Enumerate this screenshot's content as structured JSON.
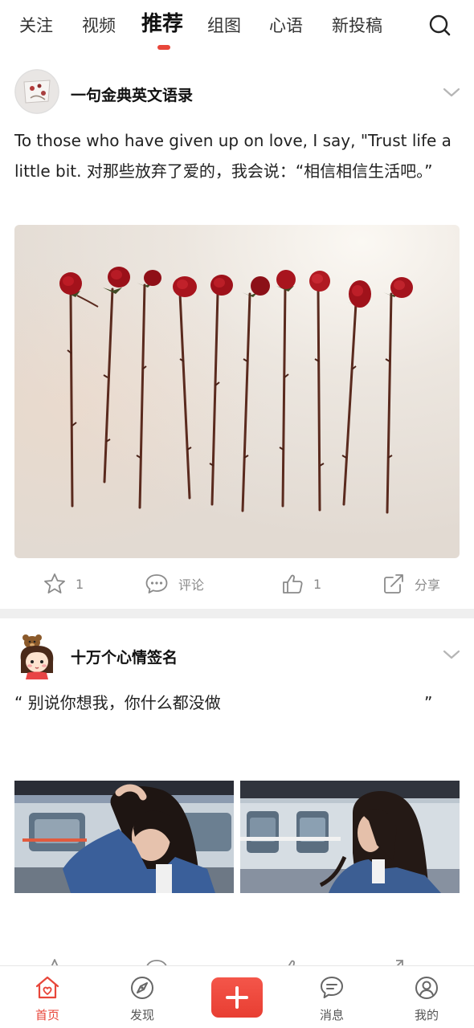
{
  "tabs": [
    {
      "label": "关注"
    },
    {
      "label": "视频"
    },
    {
      "label": "推荐"
    },
    {
      "label": "组图"
    },
    {
      "label": "心语"
    },
    {
      "label": "新投稿"
    }
  ],
  "active_tab": "推荐",
  "posts": [
    {
      "author": "一句金典英文语录",
      "text": "To those who have given up on love, I say, \"Trust life a little bit. 对那些放弃了爱的，我会说：“相信相信生活吧。”",
      "actions": {
        "favorite_count": "1",
        "comment_label": "评论",
        "like_count": "1",
        "share_label": "分享"
      }
    },
    {
      "author": "十万个心情签名",
      "text_open": "“ 别说你想我，你什么都没做",
      "text_close": "”"
    }
  ],
  "bottom_nav": [
    {
      "label": "首页"
    },
    {
      "label": "发现"
    },
    {
      "label": "消息"
    },
    {
      "label": "我的"
    }
  ],
  "colors": {
    "accent": "#e8463a",
    "text_primary": "#222222",
    "text_secondary": "#8a8a8a",
    "separator": "#efefef"
  },
  "icons": [
    "search-icon",
    "chevron-down-icon",
    "star-icon",
    "comment-icon",
    "thumbs-up-icon",
    "share-icon",
    "home-icon",
    "discover-icon",
    "plus-icon",
    "message-icon",
    "profile-icon"
  ]
}
